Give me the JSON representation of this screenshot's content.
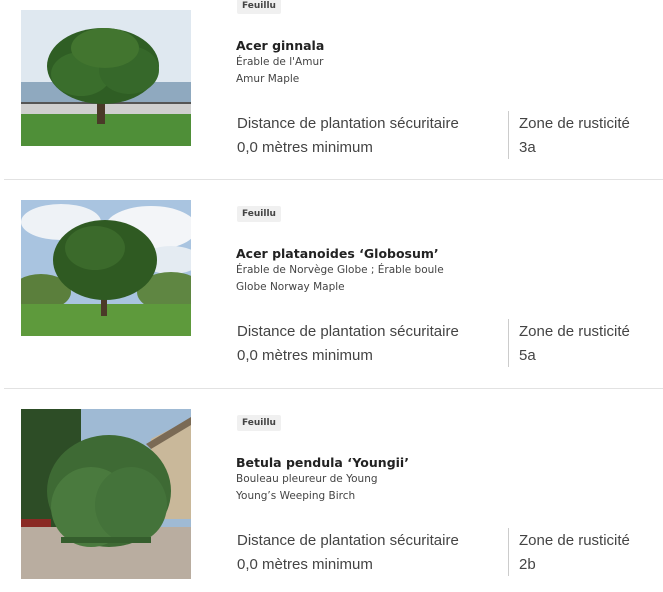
{
  "trees": [
    {
      "badge": "Feuillu",
      "latin_name": "Acer ginnala",
      "common_fr": "Érable de l'Amur",
      "common_en": "Amur Maple",
      "distance_label": "Distance de plantation sécuritaire",
      "distance_value": "0,0 mètres minimum",
      "zone_label": "Zone de rusticité",
      "zone_value": "3a"
    },
    {
      "badge": "Feuillu",
      "latin_name": "Acer platanoides ‘Globosum’",
      "common_fr": "Érable de Norvège Globe ; Érable boule",
      "common_en": "Globe Norway Maple",
      "distance_label": "Distance de plantation sécuritaire",
      "distance_value": "0,0 mètres minimum",
      "zone_label": "Zone de rusticité",
      "zone_value": "5a"
    },
    {
      "badge": "Feuillu",
      "latin_name": "Betula pendula ‘Youngii’",
      "common_fr": "Bouleau pleureur de Young",
      "common_en": "Young’s Weeping Birch",
      "distance_label": "Distance de plantation sécuritaire",
      "distance_value": "0,0 mètres minimum",
      "zone_label": "Zone de rusticité",
      "zone_value": "2b"
    }
  ]
}
